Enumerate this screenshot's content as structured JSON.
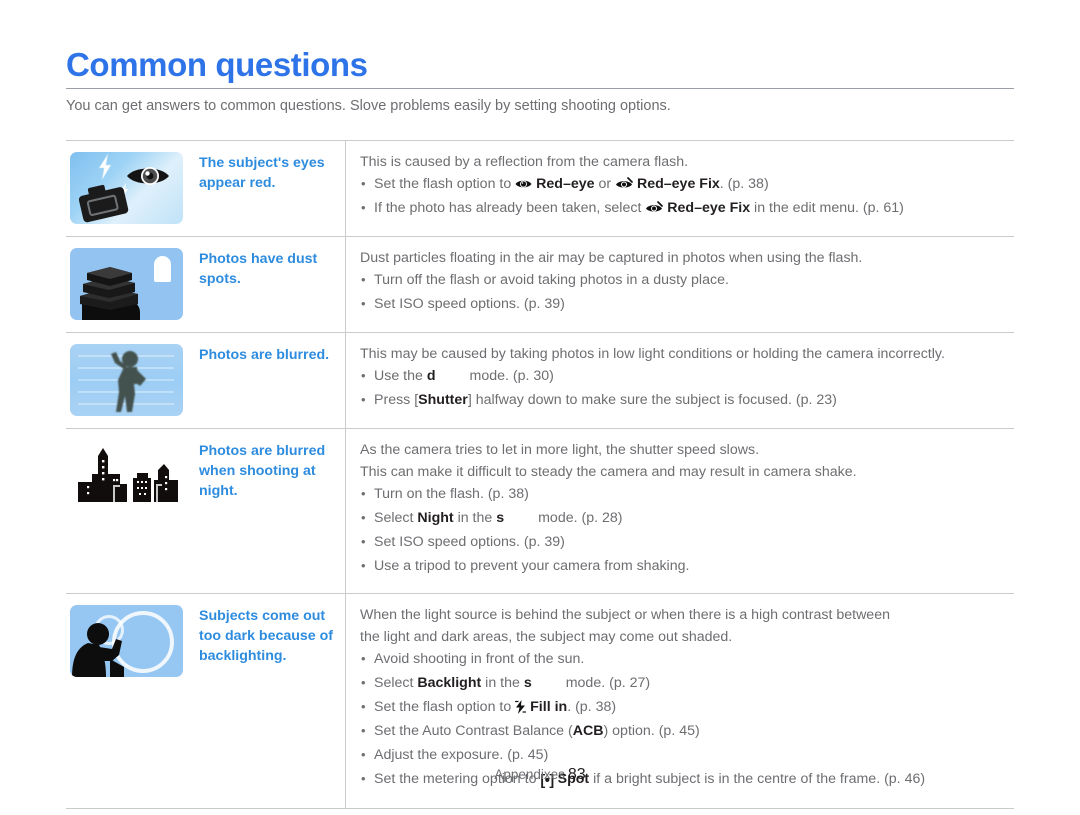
{
  "document": {
    "title": "Common questions",
    "intro": "You can get answers to common questions. Slove problems easily by setting shooting options.",
    "accent_color": "#2e74e8",
    "issue_color": "#2e8cdf",
    "body_color": "#6d6e71"
  },
  "footer": {
    "section": "Appendixes",
    "page_number": "83"
  },
  "rows": [
    {
      "illustration": "camera-flash-red-eye-illustration",
      "issue": "The subject's eyes appear red.",
      "lead": "This is caused by a reflection from the camera flash.",
      "bullets": [
        {
          "parts": [
            {
              "t": "text",
              "v": "Set the flash option to "
            },
            {
              "t": "icon",
              "v": "red-eye-icon"
            },
            {
              "t": "bold",
              "v": "Red–eye"
            },
            {
              "t": "text",
              "v": " or "
            },
            {
              "t": "icon",
              "v": "red-eye-fix-icon"
            },
            {
              "t": "bold",
              "v": "Red–eye Fix"
            },
            {
              "t": "text",
              "v": ". (p. 38)"
            }
          ]
        },
        {
          "parts": [
            {
              "t": "text",
              "v": "If the photo has already been taken, select "
            },
            {
              "t": "icon",
              "v": "red-eye-fix-icon"
            },
            {
              "t": "bold",
              "v": "Red–eye Fix"
            },
            {
              "t": "text",
              "v": " in the edit menu. (p. 61)"
            }
          ]
        }
      ]
    },
    {
      "illustration": "dusty-books-stack-illustration",
      "issue": "Photos have dust spots.",
      "lead": "Dust particles floating in the air may be captured in photos when using the flash.",
      "bullets": [
        {
          "parts": [
            {
              "t": "text",
              "v": "Turn off the flash or avoid taking photos in a dusty place."
            }
          ]
        },
        {
          "parts": [
            {
              "t": "text",
              "v": "Set ISO speed options. (p. 39)"
            }
          ]
        }
      ]
    },
    {
      "illustration": "blurred-person-illustration",
      "issue": "Photos are blurred.",
      "lead": "This may be caused by taking photos in low light conditions or holding the camera incorrectly.",
      "bullets": [
        {
          "parts": [
            {
              "t": "text",
              "v": "Use the "
            },
            {
              "t": "bold",
              "v": "d"
            },
            {
              "t": "gap",
              "v": ""
            },
            {
              "t": "text",
              "v": "mode. (p. 30)"
            }
          ]
        },
        {
          "parts": [
            {
              "t": "text",
              "v": "Press ["
            },
            {
              "t": "bold",
              "v": "Shutter"
            },
            {
              "t": "text",
              "v": "] halfway down to make sure the subject is focused. (p. 23)"
            }
          ]
        }
      ]
    },
    {
      "illustration": "night-city-skyline-illustration",
      "issue": "Photos are blurred when shooting at night.",
      "lead": "As the camera tries to let in more light, the shutter speed slows.",
      "lead2": "This can make it difficult to steady the camera and may result in camera shake.",
      "bullets": [
        {
          "parts": [
            {
              "t": "text",
              "v": "Turn on the flash. (p. 38)"
            }
          ]
        },
        {
          "parts": [
            {
              "t": "text",
              "v": "Select "
            },
            {
              "t": "bold",
              "v": "Night"
            },
            {
              "t": "text",
              "v": " in the "
            },
            {
              "t": "bold",
              "v": "s"
            },
            {
              "t": "gap",
              "v": ""
            },
            {
              "t": "text",
              "v": "mode. (p. 28)"
            }
          ]
        },
        {
          "parts": [
            {
              "t": "text",
              "v": "Set ISO speed options. (p. 39)"
            }
          ]
        },
        {
          "parts": [
            {
              "t": "text",
              "v": "Use a tripod to prevent your camera from shaking."
            }
          ]
        }
      ]
    },
    {
      "illustration": "backlit-subject-sun-illustration",
      "issue": "Subjects come out too dark because of backlighting.",
      "lead": "When the light source is behind the subject or when there is a high contrast between",
      "lead2": "the light and dark areas, the subject may come out shaded.",
      "bullets": [
        {
          "parts": [
            {
              "t": "text",
              "v": "Avoid shooting in front of the sun."
            }
          ]
        },
        {
          "parts": [
            {
              "t": "text",
              "v": "Select "
            },
            {
              "t": "bold",
              "v": "Backlight"
            },
            {
              "t": "text",
              "v": " in the "
            },
            {
              "t": "bold",
              "v": "s"
            },
            {
              "t": "gap",
              "v": ""
            },
            {
              "t": "text",
              "v": "mode. (p. 27)"
            }
          ]
        },
        {
          "parts": [
            {
              "t": "text",
              "v": "Set the flash option to "
            },
            {
              "t": "icon",
              "v": "flash-fill-in-icon"
            },
            {
              "t": "bold",
              "v": "Fill in"
            },
            {
              "t": "text",
              "v": ". (p. 38)"
            }
          ]
        },
        {
          "parts": [
            {
              "t": "text",
              "v": "Set the Auto Contrast Balance ("
            },
            {
              "t": "bold",
              "v": "ACB"
            },
            {
              "t": "text",
              "v": ") option. (p. 45)"
            }
          ]
        },
        {
          "parts": [
            {
              "t": "text",
              "v": "Adjust the exposure. (p. 45)"
            }
          ]
        },
        {
          "parts": [
            {
              "t": "text",
              "v": "Set the metering option to "
            },
            {
              "t": "icon",
              "v": "spot-metering-icon"
            },
            {
              "t": "bold",
              "v": "Spot"
            },
            {
              "t": "text",
              "v": " if a bright subject is in the centre of the frame. (p. 46)"
            }
          ]
        }
      ]
    }
  ]
}
